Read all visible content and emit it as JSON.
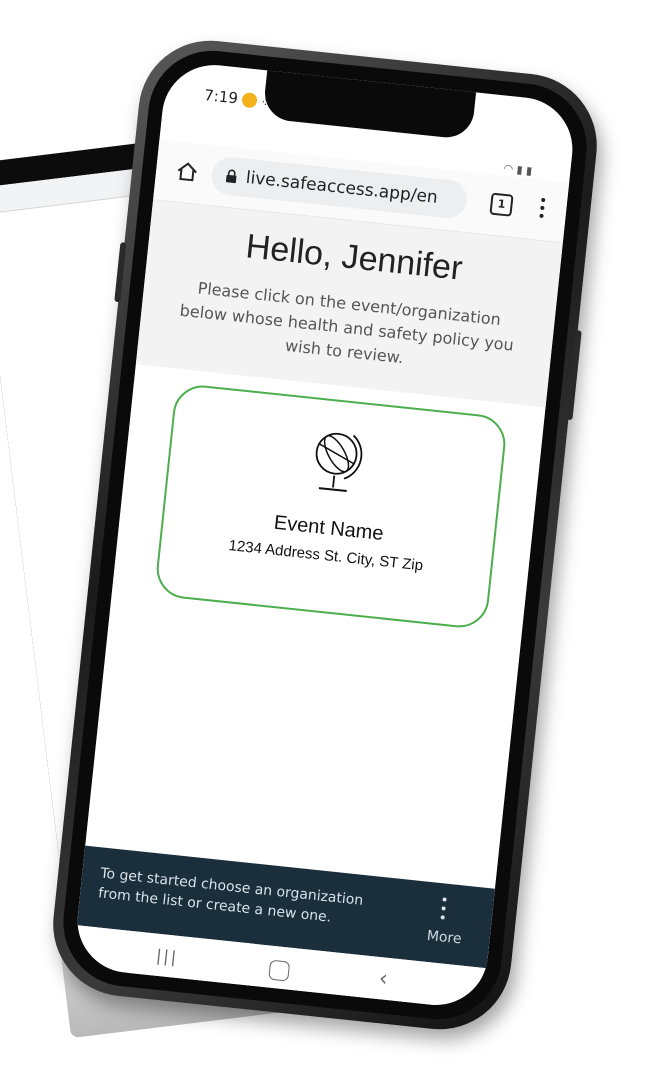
{
  "status_bar": {
    "time": "7:19"
  },
  "browser": {
    "url": "live.safeaccess.app/en",
    "tab_count": "1"
  },
  "page": {
    "greeting": "Hello, Jennifer",
    "instructions": "Please click on the event/organization below whose health and safety policy you wish to review."
  },
  "event_card": {
    "name": "Event Name",
    "address": "1234 Address St. City, ST Zip",
    "border_color": "#4cae4c"
  },
  "banner": {
    "text": "To get started choose an organization from the list or create a new one.",
    "more_label": "More",
    "background": "#1a2e3b"
  },
  "icons": {
    "home": "home-icon",
    "lock": "lock-icon",
    "tabs": "tab-switcher-icon",
    "menu": "overflow-menu-icon",
    "globe": "globe-icon",
    "more": "more-icon",
    "nav_recents": "recents-icon",
    "nav_home": "nav-home-icon",
    "nav_back": "back-icon"
  }
}
